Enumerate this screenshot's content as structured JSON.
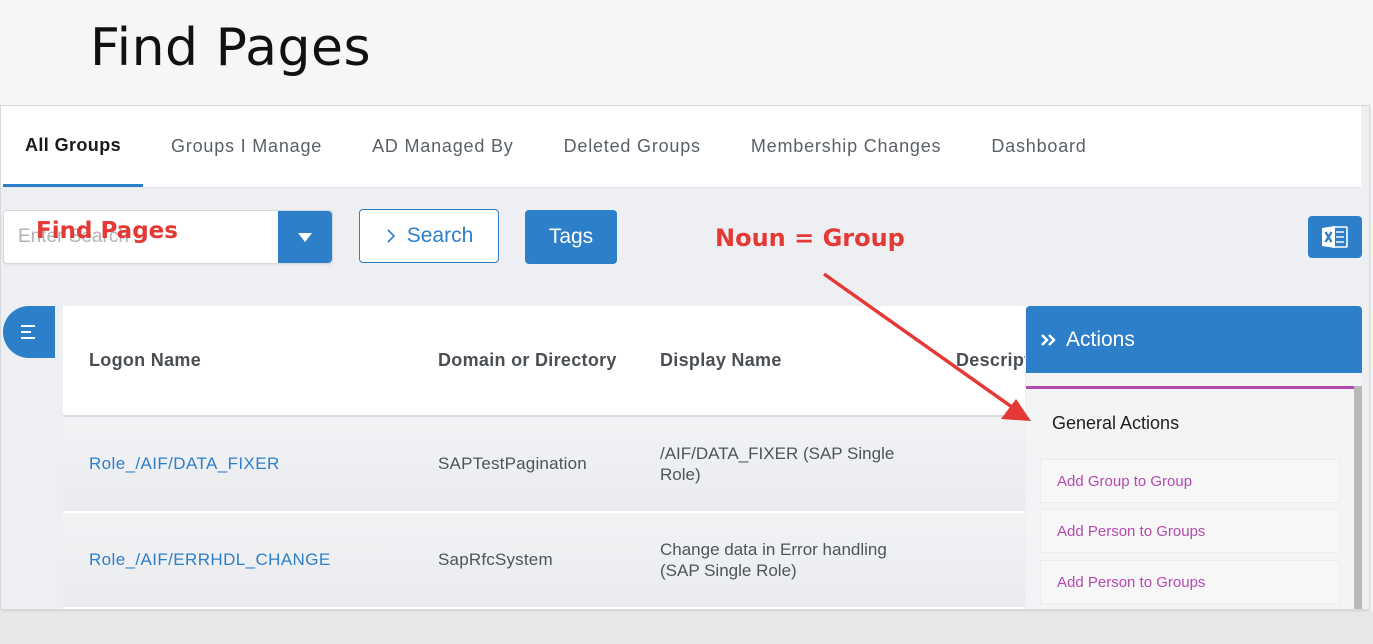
{
  "slide_title": "Find Pages",
  "tabs": [
    {
      "label": "All Groups",
      "active": true
    },
    {
      "label": "Groups I Manage",
      "active": false
    },
    {
      "label": "AD Managed By",
      "active": false
    },
    {
      "label": "Deleted Groups",
      "active": false
    },
    {
      "label": "Membership Changes",
      "active": false
    },
    {
      "label": "Dashboard",
      "active": false
    }
  ],
  "search": {
    "placeholder": "Enter Search",
    "button_label": "Search",
    "tags_label": "Tags"
  },
  "annotations": {
    "find_pages": "Find Pages",
    "noun": "Noun = Group"
  },
  "table": {
    "headers": [
      "Logon Name",
      "Domain or Directory",
      "Display Name",
      "Descript"
    ],
    "rows": [
      {
        "logon": "Role_/AIF/DATA_FIXER",
        "domain": "SAPTestPagination",
        "display": "/AIF/DATA_FIXER (SAP Single Role)"
      },
      {
        "logon": "Role_/AIF/ERRHDL_CHANGE",
        "domain": "SapRfcSystem",
        "display": "Change data in Error handling (SAP Single Role)"
      }
    ]
  },
  "actions": {
    "header": "Actions",
    "section_title": "General Actions",
    "items": [
      "Add Group to Group",
      "Add Person to Groups",
      "Add Person to Groups"
    ]
  },
  "colors": {
    "primary": "#2d7fc9",
    "annotation": "#e53935",
    "action_link": "#b44ab0"
  },
  "icons": [
    "dropdown-caret-icon",
    "chevron-right-icon",
    "excel-icon",
    "menu-lines-icon",
    "double-chevron-icon"
  ]
}
